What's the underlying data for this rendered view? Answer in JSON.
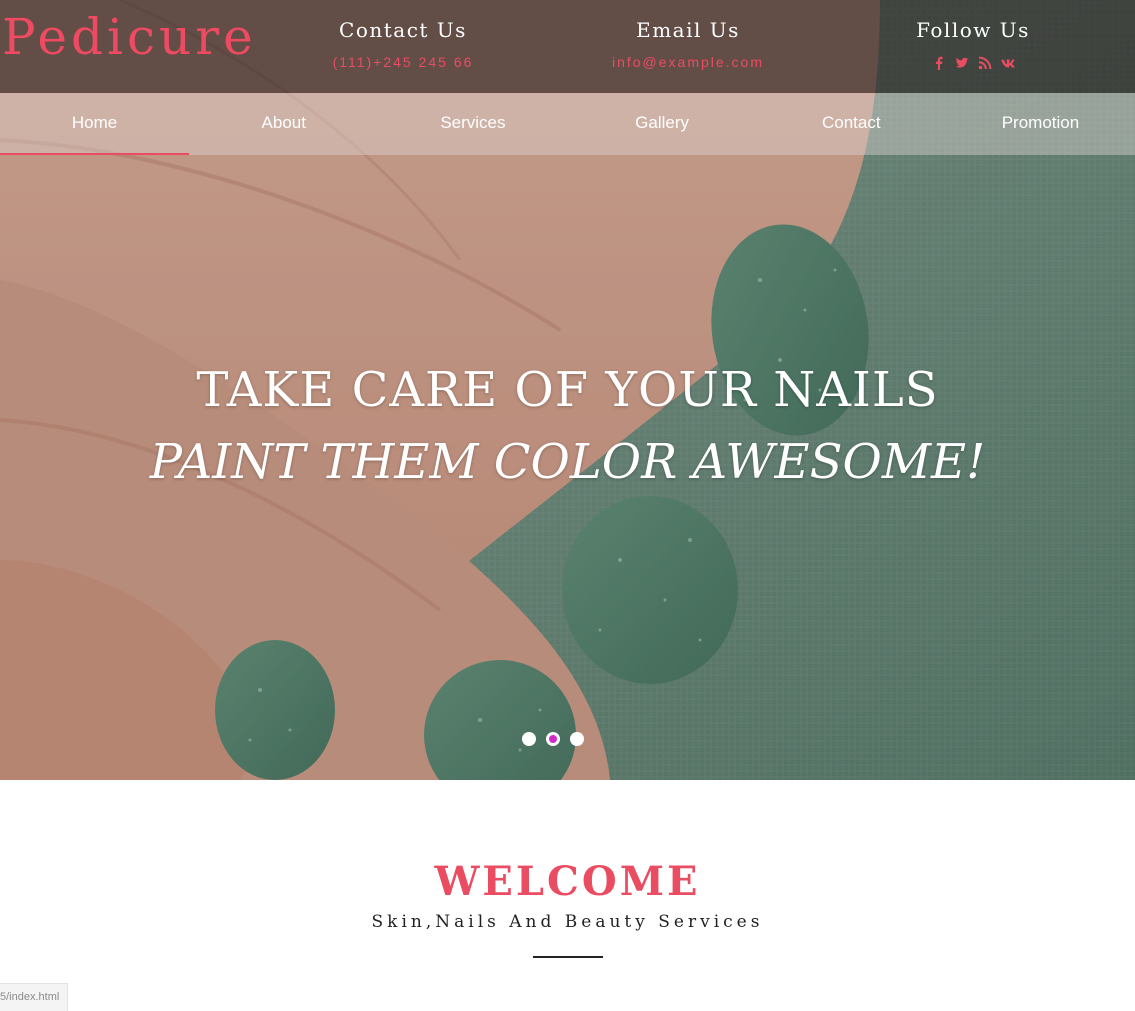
{
  "header": {
    "logo": "Pedicure",
    "contact": {
      "heading": "Contact Us",
      "value": "(111)+245 245 66"
    },
    "email": {
      "heading": "Email Us",
      "value": "info@example.com"
    },
    "follow": {
      "heading": "Follow Us",
      "icons": [
        "facebook-icon",
        "twitter-icon",
        "rss-icon",
        "vk-icon"
      ]
    }
  },
  "nav": {
    "items": [
      {
        "label": "Home",
        "active": true
      },
      {
        "label": "About"
      },
      {
        "label": "Services"
      },
      {
        "label": "Gallery"
      },
      {
        "label": "Contact"
      },
      {
        "label": "Promotion"
      }
    ]
  },
  "hero": {
    "line1": "TAKE CARE OF YOUR NAILS",
    "line2": "PAINT THEM COLOR AWESOME!",
    "slides": 3,
    "active_slide": 2
  },
  "welcome": {
    "title": "WELCOME",
    "subtitle": "Skin,Nails And Beauty Services"
  },
  "status": {
    "url": "5/index.html"
  },
  "colors": {
    "accent": "#ea4c62",
    "dot_active": "#d12ac9"
  }
}
